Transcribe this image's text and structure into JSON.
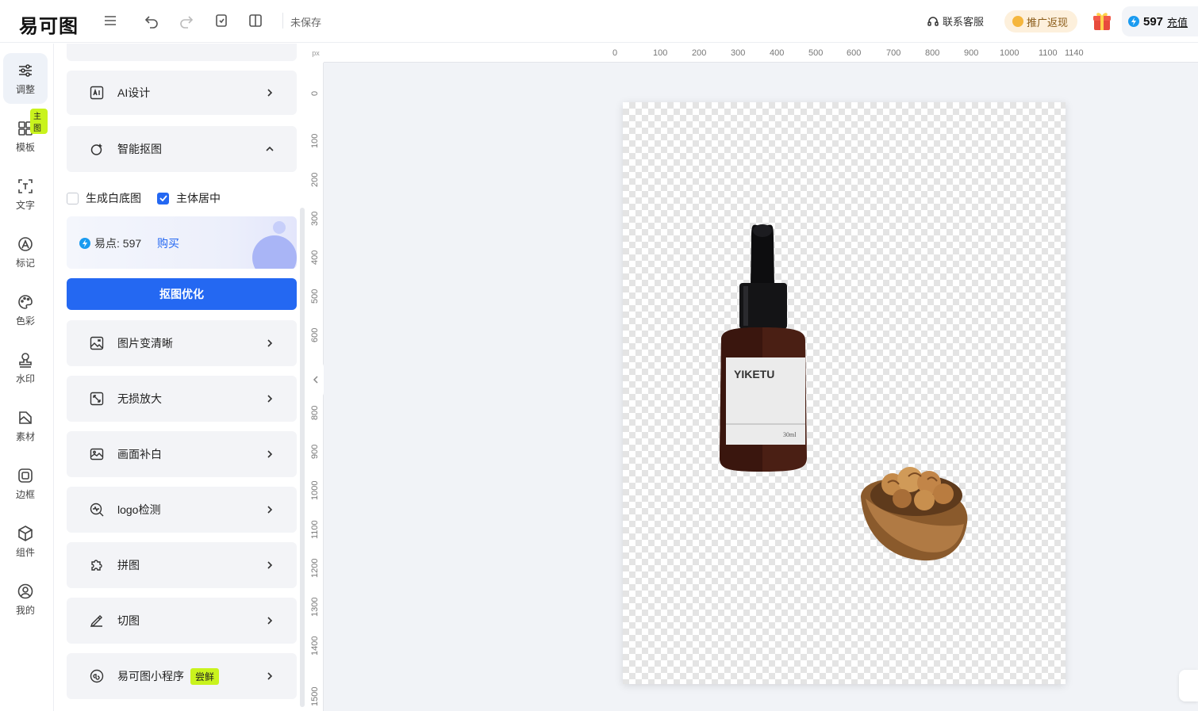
{
  "app": {
    "logo": "易可图",
    "status": "未保存"
  },
  "topbar": {
    "support": "联系客服",
    "promo": "推广返现",
    "points": "597",
    "recharge": "充值"
  },
  "nav": [
    {
      "label": "调整",
      "icon": "sliders-icon"
    },
    {
      "label": "模板",
      "icon": "grid-icon",
      "badge": "主图"
    },
    {
      "label": "文字",
      "icon": "text-icon"
    },
    {
      "label": "标记",
      "icon": "mark-icon"
    },
    {
      "label": "色彩",
      "icon": "palette-icon"
    },
    {
      "label": "水印",
      "icon": "watermark-icon"
    },
    {
      "label": "素材",
      "icon": "material-icon"
    },
    {
      "label": "边框",
      "icon": "frame-icon"
    },
    {
      "label": "组件",
      "icon": "component-icon"
    },
    {
      "label": "我的",
      "icon": "user-icon"
    }
  ],
  "panel": {
    "ai_design": "AI设计",
    "smart_cutout": "智能抠图",
    "check_white_bg": "生成白底图",
    "check_center": "主体居中",
    "points_label": "易点: 597",
    "buy": "购买",
    "optimize_button": "抠图优化",
    "items": [
      {
        "label": "图片变清晰",
        "icon": "hd-icon"
      },
      {
        "label": "无损放大",
        "icon": "expand-icon"
      },
      {
        "label": "画面补白",
        "icon": "image-fill-icon"
      },
      {
        "label": "logo检测",
        "icon": "logo-detect-icon"
      },
      {
        "label": "拼图",
        "icon": "puzzle-icon"
      },
      {
        "label": "切图",
        "icon": "cut-icon"
      },
      {
        "label": "易可图小程序",
        "icon": "miniapp-icon",
        "badge": "尝鲜"
      }
    ]
  },
  "ruler": {
    "unit": "px",
    "top": [
      "0",
      "100",
      "200",
      "300",
      "400",
      "500",
      "600",
      "700",
      "800",
      "900",
      "1000",
      "1100",
      "1140"
    ],
    "left": [
      "0",
      "100",
      "200",
      "300",
      "400",
      "500",
      "600",
      "800",
      "900",
      "1000",
      "1100",
      "1200",
      "1300",
      "1400",
      "1500"
    ]
  },
  "canvas": {
    "bottle_brand": "YIKETU",
    "bottle_volume": "30ml"
  },
  "colors": {
    "accent": "#2468f2",
    "badge": "#c9f31d"
  }
}
